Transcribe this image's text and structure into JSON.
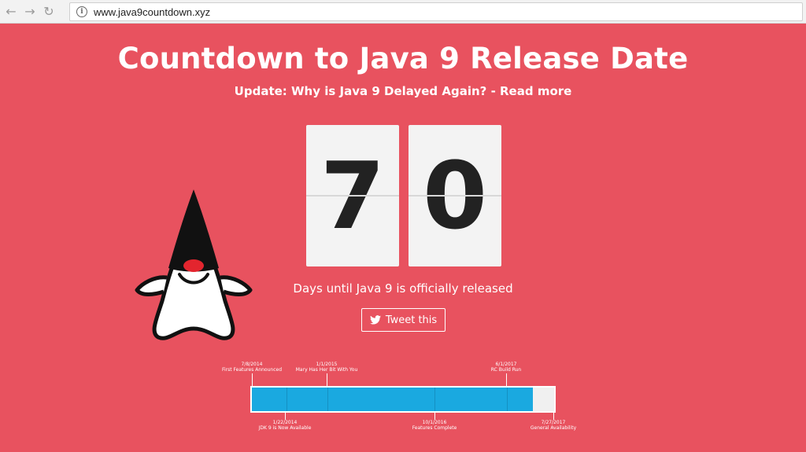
{
  "browser": {
    "url": "www.java9countdown.xyz",
    "info_glyph": "i"
  },
  "page": {
    "title": "Countdown to Java 9 Release Date",
    "update": "Update: Why is Java 9 Delayed Again? - Read more",
    "digits": [
      "7",
      "0"
    ],
    "days_caption": "Days until Java 9 is officially released",
    "tweet_label": "Tweet this"
  },
  "timeline": {
    "progress_percent": 93,
    "top_milestones": [
      {
        "date": "7/8/2014",
        "label": "First Features Announced"
      },
      {
        "date": "1/1/2015",
        "label": "Mary Has Her Bit With You"
      },
      {
        "date": "6/1/2017",
        "label": "RC Build Run"
      }
    ],
    "bottom_milestones": [
      {
        "date": "1/22/2014",
        "label": "JDK 9 is Now Available"
      },
      {
        "date": "10/1/2016",
        "label": "Features Complete"
      },
      {
        "date": "7/27/2017",
        "label": "General Availability"
      }
    ]
  },
  "colors": {
    "background": "#e8525f",
    "progress": "#1aa9e0",
    "card": "#f3f3f3"
  }
}
